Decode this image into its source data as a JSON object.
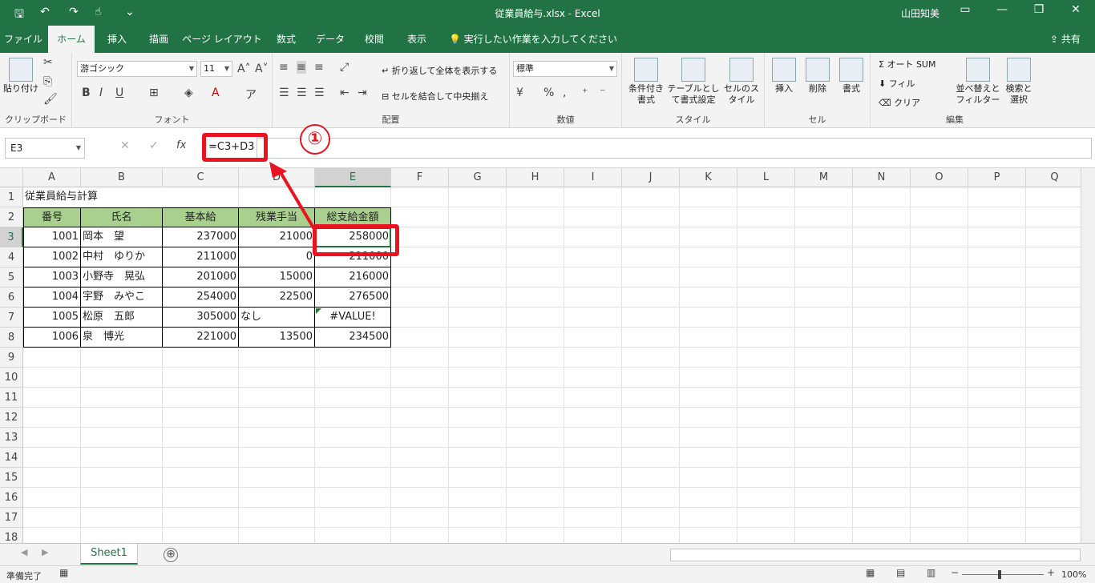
{
  "window": {
    "title": "従業員給与.xlsx  -  Excel",
    "user": "山田知美",
    "minimize": "—",
    "restore": "❐",
    "close": "✕"
  },
  "tabs": [
    "ファイル",
    "ホーム",
    "挿入",
    "描画",
    "ページ レイアウト",
    "数式",
    "データ",
    "校閲",
    "表示"
  ],
  "tell_me": "実行したい作業を入力してください",
  "share": "共有",
  "ribbon": {
    "clipboard": {
      "label": "クリップボード",
      "paste": "貼り付け"
    },
    "font": {
      "label": "フォント",
      "font_name": "游ゴシック",
      "font_size": "11"
    },
    "alignment": {
      "label": "配置",
      "wrap_text": "折り返して全体を表示する",
      "merge_center": "セルを結合して中央揃え"
    },
    "number": {
      "label": "数値",
      "format": "標準"
    },
    "styles": {
      "label": "スタイル",
      "conditional": "条件付き書式",
      "table": "テーブルとして書式設定",
      "cell_styles": "セルのスタイル"
    },
    "cells": {
      "label": "セル",
      "insert": "挿入",
      "delete": "削除",
      "format": "書式"
    },
    "editing": {
      "label": "編集",
      "autosum": "オート SUM",
      "fill": "フィル",
      "clear": "クリア",
      "sort_filter": "並べ替えとフィルター",
      "find_select": "検索と選択"
    }
  },
  "formula_bar": {
    "name_box": "E3",
    "fx": "fx",
    "formula": "=C3+D3"
  },
  "annotation": {
    "badge": "①"
  },
  "columns": [
    "A",
    "B",
    "C",
    "D",
    "E",
    "F",
    "G",
    "H",
    "I",
    "J",
    "K",
    "L",
    "M",
    "N",
    "O",
    "P",
    "Q"
  ],
  "row_numbers": [
    "1",
    "2",
    "3",
    "4",
    "5",
    "6",
    "7",
    "8",
    "9",
    "10",
    "11",
    "12",
    "13",
    "14",
    "15",
    "16",
    "17",
    "18"
  ],
  "sheet_title": "従業員給与計算",
  "table": {
    "headers": [
      "番号",
      "氏名",
      "基本給",
      "残業手当",
      "総支給金額"
    ],
    "rows": [
      [
        "1001",
        "岡本　望",
        "237000",
        "21000",
        "258000"
      ],
      [
        "1002",
        "中村　ゆりか",
        "211000",
        "0",
        "211000"
      ],
      [
        "1003",
        "小野寺　晃弘",
        "201000",
        "15000",
        "216000"
      ],
      [
        "1004",
        "宇野　みやこ",
        "254000",
        "22500",
        "276500"
      ],
      [
        "1005",
        "松原　五郎",
        "305000",
        "なし",
        "#VALUE!"
      ],
      [
        "1006",
        "泉　博光",
        "221000",
        "13500",
        "234500"
      ]
    ]
  },
  "sheet_tab": "Sheet1",
  "add_sheet": "⊕",
  "status": {
    "text": "準備完了",
    "zoom": "100%"
  },
  "colors": {
    "accent": "#217346",
    "header_fill": "#a9d08e",
    "annotation": "#e8141f"
  }
}
